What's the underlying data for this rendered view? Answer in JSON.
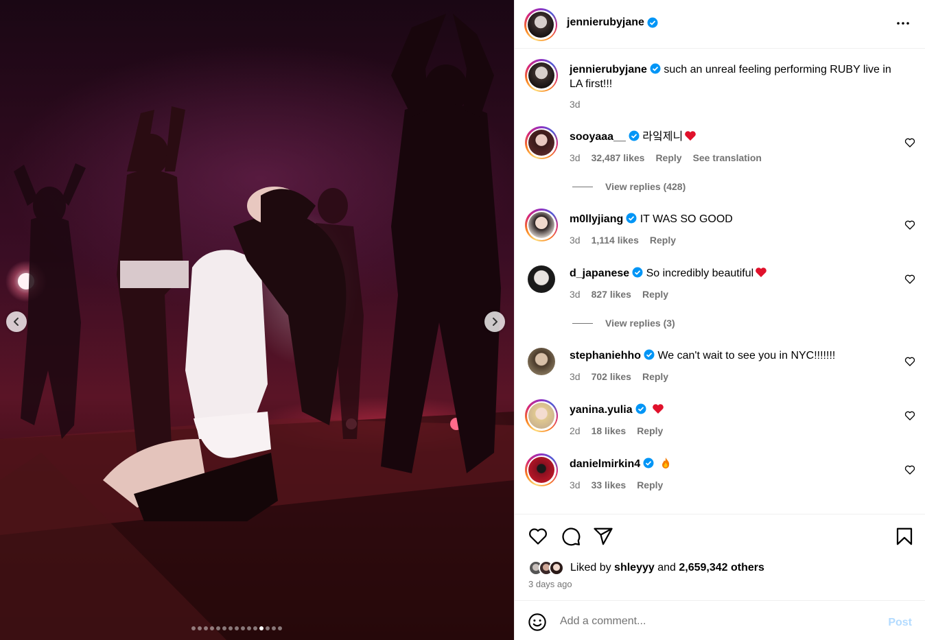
{
  "post": {
    "author": "jennierubyjane",
    "caption": "such an unreal feeling performing RUBY live in LA first!!!",
    "caption_time": "3d",
    "media": {
      "description_icon": "concert-photo",
      "slide_count": 15,
      "active_index": 11
    }
  },
  "comments": [
    {
      "user": "sooyaaa__",
      "text": "라잌제니",
      "emoji": "red-heart",
      "time": "3d",
      "likes": "32,487 likes",
      "reply": "Reply",
      "translate": "See translation",
      "replies": "View replies (428)"
    },
    {
      "user": "m0llyjiang",
      "text": "IT WAS SO GOOD",
      "emoji": "",
      "time": "3d",
      "likes": "1,114 likes",
      "reply": "Reply"
    },
    {
      "user": "d_japanese",
      "text": "So incredibly beautiful",
      "emoji": "red-heart",
      "time": "3d",
      "likes": "827 likes",
      "reply": "Reply",
      "replies": "View replies (3)"
    },
    {
      "user": "stephaniehho",
      "text": "We can't wait to see you in NYC!!!!!!!",
      "emoji": "",
      "time": "3d",
      "likes": "702 likes",
      "reply": "Reply"
    },
    {
      "user": "yanina.yulia",
      "text": "",
      "emoji": "red-heart",
      "time": "2d",
      "likes": "18 likes",
      "reply": "Reply"
    },
    {
      "user": "danielmirkin4",
      "text": "",
      "emoji": "fire",
      "time": "3d",
      "likes": "33 likes",
      "reply": "Reply"
    }
  ],
  "likes": {
    "prefix": "Liked by",
    "user": "shleyyy",
    "and": "and",
    "others": "2,659,342 others",
    "posted": "3 days ago"
  },
  "composer": {
    "placeholder": "Add a comment...",
    "post_label": "Post"
  },
  "colors": {
    "verified": "#0095f6",
    "muted": "#737373",
    "post_disabled": "#b3dbff",
    "heart": "#ff3040"
  }
}
